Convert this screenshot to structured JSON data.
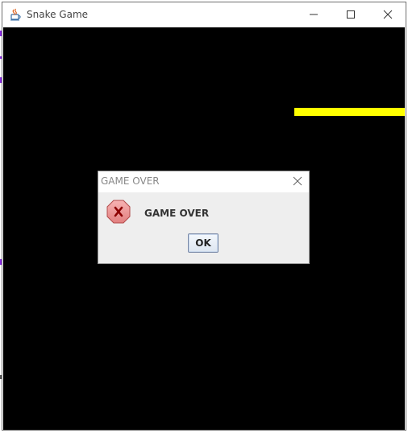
{
  "window": {
    "title": "Snake Game",
    "app_icon": "java-coffee-icon",
    "controls": {
      "minimize": "minimize-icon",
      "maximize": "maximize-icon",
      "close": "close-icon"
    }
  },
  "game": {
    "background_color": "#000000",
    "snake_color": "#ffff00"
  },
  "dialog": {
    "title": "GAME OVER",
    "message": "GAME OVER",
    "icon": "error-icon",
    "ok_label": "OK",
    "close_icon": "close-icon"
  }
}
